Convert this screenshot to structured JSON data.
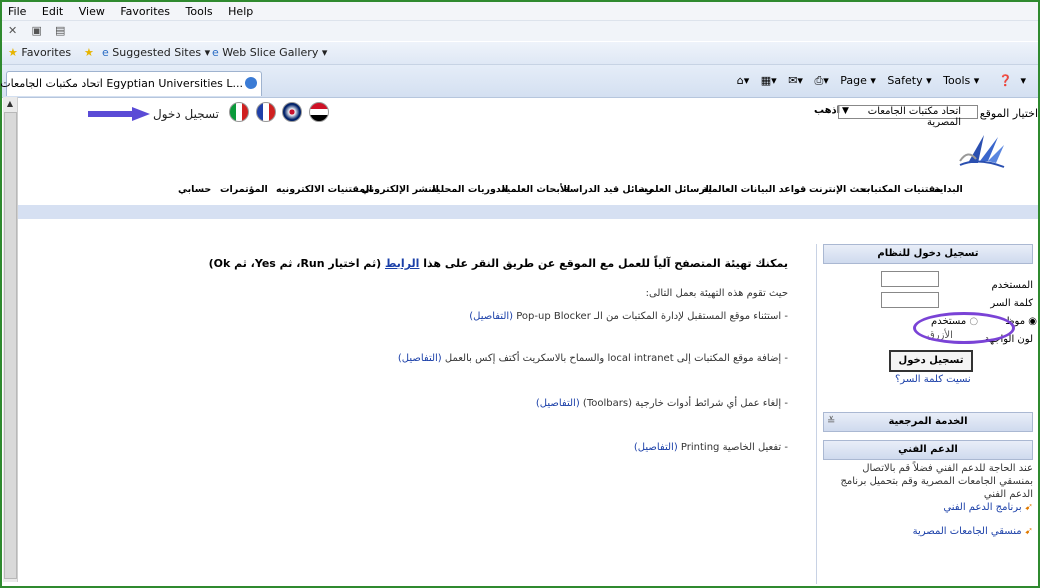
{
  "menu": [
    "File",
    "Edit",
    "View",
    "Favorites",
    "Tools",
    "Help"
  ],
  "favorites_bar": {
    "favorites": "Favorites",
    "suggested": "Suggested Sites ▾",
    "webslice": "Web Slice Gallery ▾"
  },
  "tab": {
    "title": "اتحاد مكتبات الجامعات المصرية Egyptian Universities L..."
  },
  "tools": {
    "page": "Page ▾",
    "safety": "Safety ▾",
    "tools": "Tools ▾",
    "help": "▾"
  },
  "site": {
    "label": "اختيار الموقع",
    "selected": "اتحاد مكتبات الجامعات المصرية",
    "go": "اذهب",
    "login_top": "تسجيل دخول"
  },
  "nav": [
    "البداية",
    "مقتنيات المكتبات",
    "بحث الإنترنت",
    "قواعد البيانات العالمية",
    "الرسائل العلمية",
    "رسائل قيد الدراسة",
    "الأبحاث العلمية",
    "الدوريات المحلية",
    "النشر الإلكتروني",
    "المقتنيات الالكترونيه",
    "المؤتمرات",
    "حسابي"
  ],
  "main": {
    "intro_pre": "يمكنك تهيئة المتصفح آلياً للعمل مع الموقع عن طريق النقر على هذا ",
    "intro_link": "الرابط",
    "intro_post": " (ثم اختيار Run، ثم Yes، ثم Ok)",
    "subtitle": "حيث تقوم هذه التهيئة بعمل التالى:",
    "items": [
      {
        "text": "- استثناء موقع المستقبل لإدارة المكتبات من الـ Pop-up Blocker ",
        "link": "(التفاصيل)"
      },
      {
        "text": "- إضافة موقع المكتبات إلى local intranet والسماح بالاسكريت أكتف إكس بالعمل ",
        "link": "(التفاصيل)"
      },
      {
        "text": "- إلغاء عمل أي شرائط أدوات خارجية (Toolbars) ",
        "link": "(التفاصيل)"
      },
      {
        "text": "- تفعيل الخاصية Printing ",
        "link": "(التفاصيل)"
      }
    ]
  },
  "panel": {
    "login_header": "تسجيل دخول للنظام",
    "user_label": "المستخدم",
    "pass_label": "كلمة السر",
    "radio1": "موظ",
    "radio2": "مستخدم",
    "ui_color": "لون الواجهة",
    "blue": "الأزرق",
    "login_btn": "تسجيل دخول",
    "forgot": "نسيت كلمة السر؟",
    "reference_header": "الخدمة المرجعية",
    "support_header": "الدعم الفني",
    "support_text": "عند الحاجة للدعم الفني فضلاً قم بالاتصال بمنسقي الجامعات المصرية وقم بتحميل برنامج الدعم الفني",
    "link1": "برنامج الدعم الفني",
    "link2": "منسقي الجامعات المصرية"
  }
}
